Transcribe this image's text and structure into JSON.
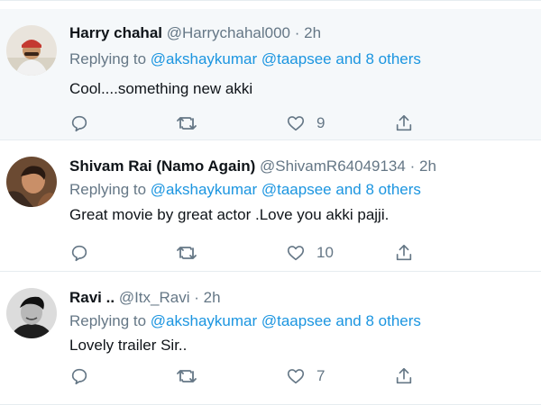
{
  "tweets": [
    {
      "name": "Harry chahal",
      "handle": "@Harrychahal000",
      "dot": "·",
      "time": "2h",
      "replying_prefix": "Replying to ",
      "mention1": "@akshaykumar",
      "mention2": "@taapsee",
      "and_others": "and 8 others",
      "text": "Cool....something new akki",
      "likes": "9",
      "avatar_icon": "profile-photo"
    },
    {
      "name": "Shivam Rai (Namo Again)",
      "handle": "@ShivamR64049134",
      "dot": "·",
      "time": "2h",
      "replying_prefix": "Replying to ",
      "mention1": "@akshaykumar",
      "mention2": "@taapsee",
      "and_others": "and 8 others",
      "text": "Great movie by great actor .Love you akki pajji.",
      "likes": "10",
      "avatar_icon": "profile-photo"
    },
    {
      "name": "Ravi ..",
      "handle": "@Itx_Ravi",
      "dot": "·",
      "time": "2h",
      "replying_prefix": "Replying to ",
      "mention1": "@akshaykumar",
      "mention2": "@taapsee",
      "and_others": "and 8 others",
      "text": "Lovely trailer Sir..",
      "likes": "7",
      "avatar_icon": "profile-photo"
    }
  ],
  "icons": {
    "reply": "reply-icon",
    "retweet": "retweet-icon",
    "like": "heart-icon",
    "share": "share-icon"
  },
  "colors": {
    "link": "#1b95e0",
    "secondary": "#657786",
    "highlight_bg": "#f5f8fa",
    "border": "#e6ecf0"
  }
}
